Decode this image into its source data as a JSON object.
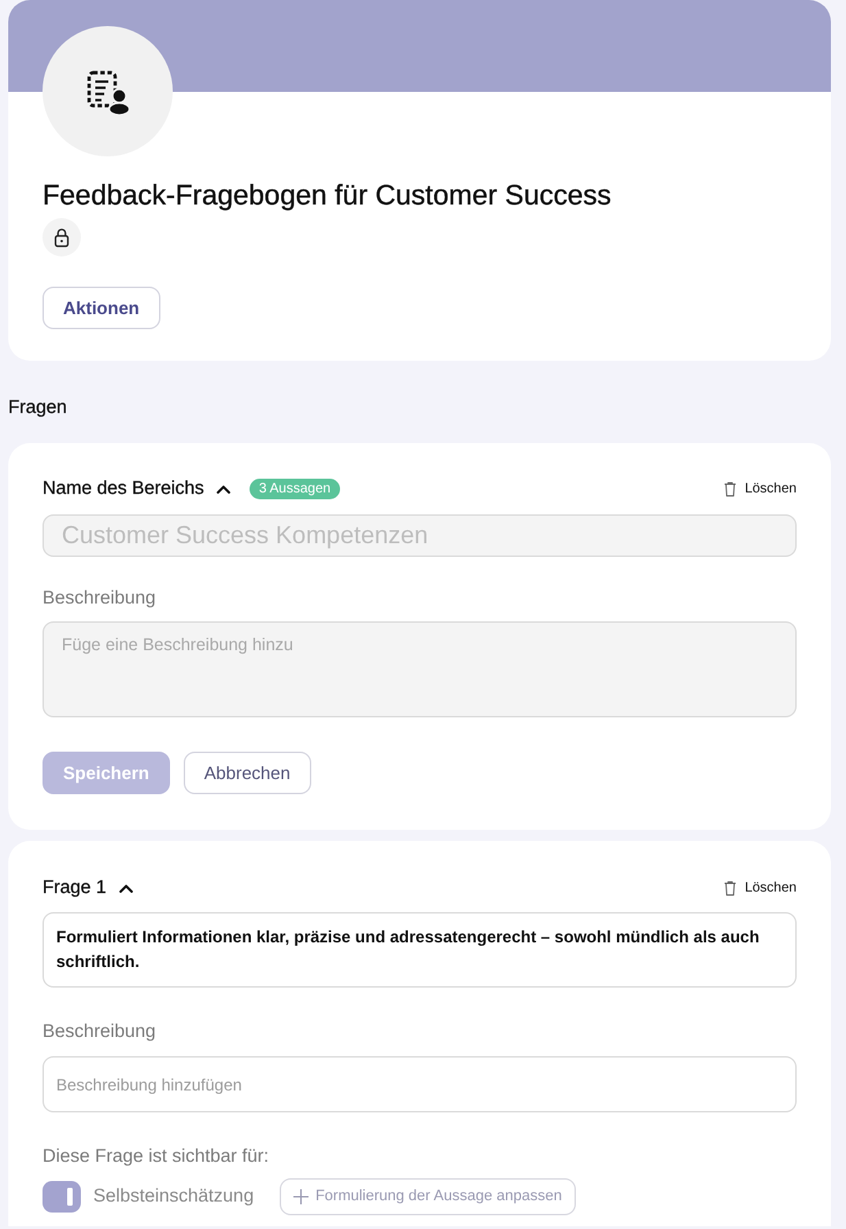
{
  "header": {
    "title": "Feedback-Fragebogen für Customer Success",
    "action_button": "Aktionen"
  },
  "section_heading": "Fragen",
  "section": {
    "title": "Name des Bereichs",
    "expanded": true,
    "badge": "3 Aussagen",
    "delete": "Löschen",
    "name_field": {
      "placeholder": "Customer Success Kompetenzen"
    },
    "description_label": "Beschreibung",
    "description_field": {
      "placeholder": "Füge eine Beschreibung hinzu"
    },
    "buttons": [
      {
        "label": "Speichern",
        "kind": "primary",
        "disabled": true
      },
      {
        "label": "Abbrechen",
        "kind": "secondary",
        "disabled": false
      }
    ]
  },
  "questions": [
    {
      "title": "Frage 1",
      "expanded": true,
      "delete": "Löschen",
      "text_field": {
        "value": "Formuliert Informationen klar, präzise und adressatengerecht – sowohl mündlich als auch schriftlich."
      },
      "description_label": "Beschreibung",
      "description_field": {
        "placeholder": "Beschreibung hinzufügen"
      },
      "visibility_label": "Diese Frage ist sichtbar für:",
      "visibility": [
        {
          "label": "Selbsteinschätzung",
          "on": true
        }
      ],
      "customize_button": "Formulierung der Aussage anpassen"
    }
  ]
}
